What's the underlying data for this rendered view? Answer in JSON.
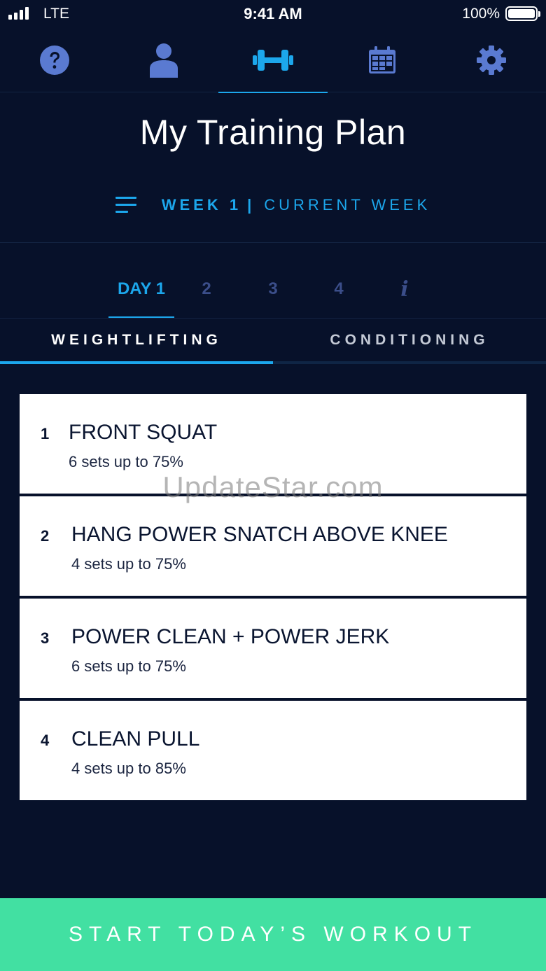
{
  "status_bar": {
    "carrier": "LTE",
    "time": "9:41 AM",
    "battery": "100%"
  },
  "top_nav": {
    "items": [
      {
        "icon": "help-icon",
        "active": false
      },
      {
        "icon": "profile-icon",
        "active": false
      },
      {
        "icon": "dumbbell-icon",
        "active": true
      },
      {
        "icon": "calendar-icon",
        "active": false
      },
      {
        "icon": "gear-icon",
        "active": false
      }
    ]
  },
  "page": {
    "title": "My Training Plan"
  },
  "week": {
    "label": "WEEK 1",
    "separator": "|",
    "current": "CURRENT WEEK"
  },
  "day_tabs": {
    "items": [
      "DAY 1",
      "2",
      "3",
      "4",
      "i"
    ],
    "active_index": 0
  },
  "category_tabs": {
    "items": [
      "WEIGHTLIFTING",
      "CONDITIONING"
    ],
    "active_index": 0
  },
  "exercises": [
    {
      "number": "1",
      "name": "FRONT SQUAT",
      "detail": "6 sets up to 75%"
    },
    {
      "number": "2",
      "name": "HANG POWER SNATCH ABOVE KNEE",
      "detail": "4 sets up to 75%"
    },
    {
      "number": "3",
      "name": "POWER CLEAN + POWER JERK",
      "detail": "6 sets up to 75%"
    },
    {
      "number": "4",
      "name": "CLEAN PULL",
      "detail": "4 sets up to 85%"
    }
  ],
  "watermark": "UpdateStar.com",
  "cta": {
    "label": "START TODAY’S WORKOUT"
  },
  "colors": {
    "background": "#07112a",
    "accent": "#1ca7ec",
    "icon_muted": "#5a7ad1",
    "cta": "#42e0a2"
  }
}
